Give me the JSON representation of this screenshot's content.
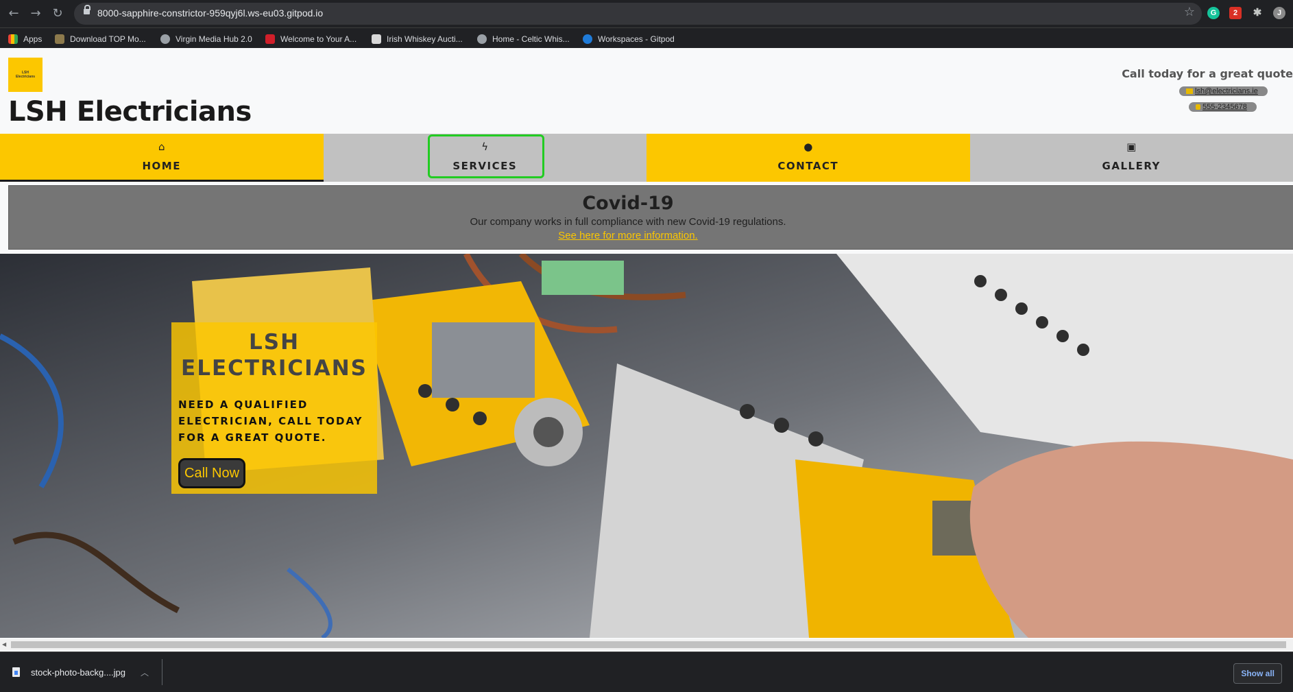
{
  "browser": {
    "url": "8000-sapphire-constrictor-959qyj6l.ws-eu03.gitpod.io",
    "bookmarks": [
      {
        "label": "Apps",
        "icon": "apps-grid-icon"
      },
      {
        "label": "Download TOP Mo...",
        "icon": "shield-icon"
      },
      {
        "label": "Virgin Media Hub 2.0",
        "icon": "globe-icon"
      },
      {
        "label": "Welcome to Your A...",
        "icon": "eir-icon"
      },
      {
        "label": "Irish Whiskey Aucti...",
        "icon": "page-icon"
      },
      {
        "label": "Home - Celtic Whis...",
        "icon": "globe-icon"
      },
      {
        "label": "Workspaces - Gitpod",
        "icon": "gitpod-icon"
      }
    ],
    "profile_initial": "J"
  },
  "header": {
    "logo_line1": "LSH",
    "logo_line2": "Electricians",
    "title": "LSH Electricians",
    "call_today": "Call today for a great quote",
    "email": "lsh@electricians.ie",
    "phone": "555-2345678"
  },
  "nav": [
    {
      "label": "HOME",
      "icon": "home-icon",
      "glyph": "⌂",
      "color": "yellow",
      "active": true
    },
    {
      "label": "SERVICES",
      "icon": "bolt-icon",
      "glyph": "ϟ",
      "color": "grey",
      "active": false
    },
    {
      "label": "CONTACT",
      "icon": "comment-icon",
      "glyph": "●",
      "color": "yellow",
      "active": false
    },
    {
      "label": "GALLERY",
      "icon": "image-icon",
      "glyph": "▣",
      "color": "grey",
      "active": false
    }
  ],
  "covid": {
    "title": "Covid-19",
    "text": "Our company works in full compliance with new Covid-19 regulations.",
    "link": "See here for more information."
  },
  "hero": {
    "heading": "LSH ELECTRICIANS",
    "sub": "NEED A QUALIFIED ELECTRICIAN, CALL TODAY FOR A GREAT QUOTE.",
    "button": "Call Now"
  },
  "downloads": {
    "file": "stock-photo-backg....jpg",
    "show_all": "Show all"
  },
  "colors": {
    "accent": "#fcc700",
    "nav_grey": "#c1c1c1",
    "banner_grey": "#757575",
    "annotation_green": "#22cc22"
  }
}
